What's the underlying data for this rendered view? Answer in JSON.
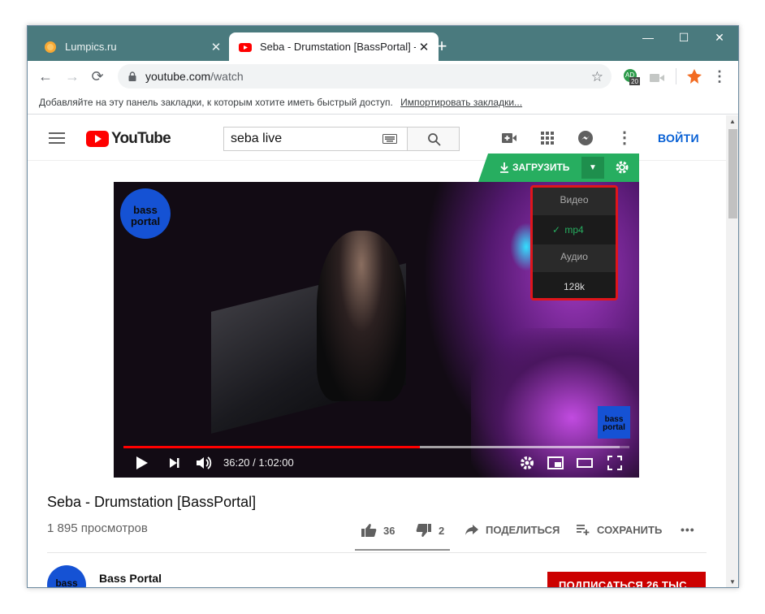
{
  "browser": {
    "tabs": [
      {
        "title": "Lumpics.ru",
        "active": false
      },
      {
        "title": "Seba - Drumstation [BassPortal] -",
        "active": true
      }
    ],
    "url_host": "youtube.com",
    "url_path": "/watch",
    "extension_badge": "20",
    "extension_avatar": "AD",
    "bookmarks_prompt": "Добавляйте на эту панель закладки, к которым хотите иметь быстрый доступ.",
    "bookmarks_import": "Импортировать закладки..."
  },
  "youtube": {
    "logo_text": "YouTube",
    "search_value": "seba live",
    "login_label": "ВОЙТИ"
  },
  "downloader": {
    "download_label": "ЗАГРУЗИТЬ",
    "menu": {
      "video_header": "Видео",
      "video_items": [
        {
          "label": "mp4",
          "selected": true
        }
      ],
      "audio_header": "Аудио",
      "audio_items": [
        {
          "label": "128k",
          "selected": false
        }
      ]
    }
  },
  "player": {
    "logo_text": "bass portal",
    "time_display": "36:20 / 1:02:00",
    "progress_fraction": 0.586,
    "buffer_fraction": 0.98
  },
  "video": {
    "title": "Seba - Drumstation [BassPortal]",
    "views": "1 895 просмотров",
    "likes": "36",
    "dislikes": "2",
    "share_label": "ПОДЕЛИТЬСЯ",
    "save_label": "СОХРАНИТЬ",
    "more": "•••"
  },
  "channel": {
    "name": "Bass Portal",
    "avatar_text": "bass",
    "subscribe_label": "ПОДПИСАТЬСЯ 26 ТЫС."
  },
  "colors": {
    "tabstrip": "#4a7a7e",
    "download_green": "#27ae60",
    "youtube_red": "#ff0000",
    "highlight_red": "#e0151b",
    "subscribe_red": "#cc0000",
    "login_blue": "#065fd4"
  }
}
